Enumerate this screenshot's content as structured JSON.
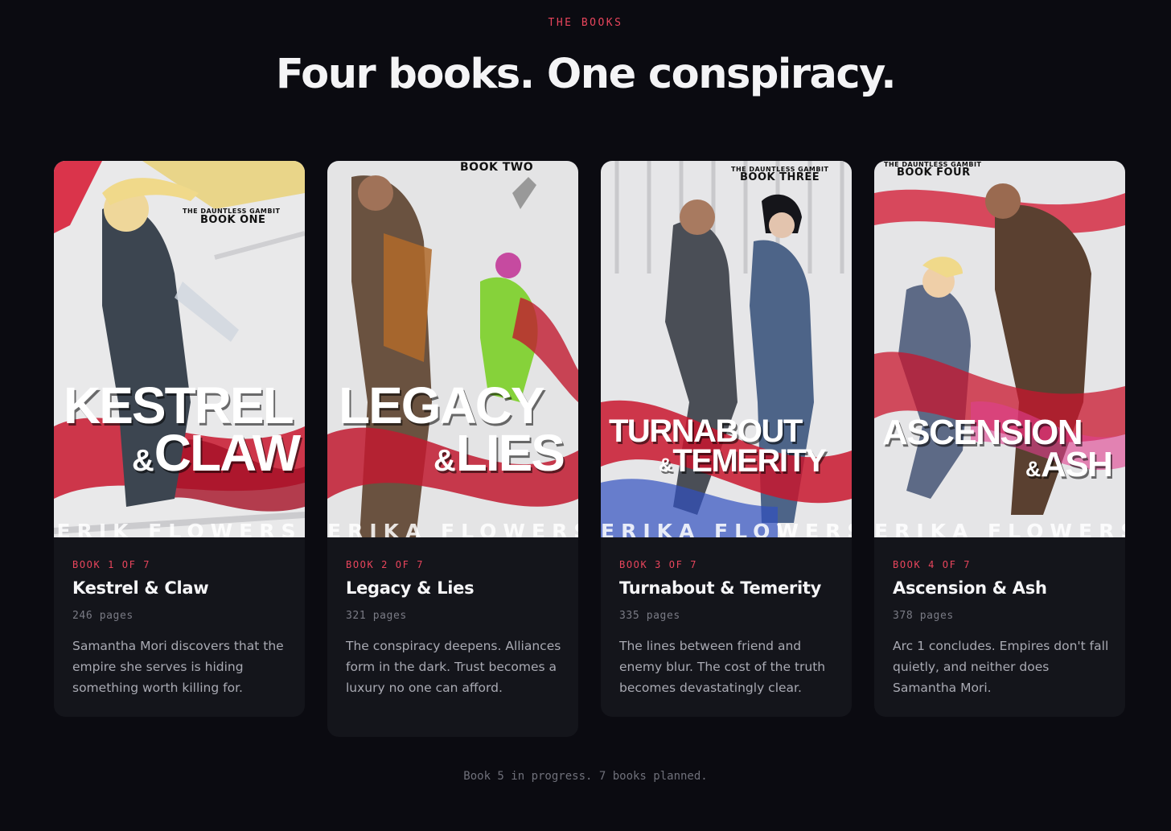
{
  "section": {
    "eyebrow": "THE BOOKS",
    "headline": "Four books. One conspiracy."
  },
  "colors": {
    "background": "#0b0b11",
    "card": "#14151b",
    "accent": "#e8455c",
    "muted": "#7a7b85"
  },
  "books": [
    {
      "series_small": "THE DAUNTLESS GAMBIT",
      "series_big": "BOOK ONE",
      "cover_title_1": "KESTREL",
      "cover_amp": "&",
      "cover_title_2": "CLAW",
      "cover_author": "ERIK FLOWERS",
      "label": "BOOK 1 OF 7",
      "title": "Kestrel & Claw",
      "pages": "246 pages",
      "description": "Samantha Mori discovers that the empire she serves is hiding something worth killing for."
    },
    {
      "series_big": "BOOK TWO",
      "cover_title_1": "LEGACY",
      "cover_amp": "&",
      "cover_title_2": "LIES",
      "cover_author": "ERIKA FLOWERS",
      "label": "BOOK 2 OF 7",
      "title": "Legacy & Lies",
      "pages": "321 pages",
      "description": "The conspiracy deepens. Alliances form in the dark. Trust becomes a luxury no one can afford."
    },
    {
      "series_small": "THE DAUNTLESS GAMBIT",
      "series_big": "BOOK THREE",
      "cover_title_1": "TURNABOUT",
      "cover_amp": "&",
      "cover_title_2": "TEMERITY",
      "cover_author": "ERIKA FLOWERS",
      "label": "BOOK 3 OF 7",
      "title": "Turnabout & Temerity",
      "pages": "335 pages",
      "description": "The lines between friend and enemy blur. The cost of the truth becomes devastatingly clear."
    },
    {
      "series_small": "THE DAUNTLESS GAMBIT",
      "series_big": "BOOK FOUR",
      "cover_title_1": "ASCENSION",
      "cover_amp": "&",
      "cover_title_2": "ASH",
      "cover_author": "ERIKA FLOWERS",
      "label": "BOOK 4 OF 7",
      "title": "Ascension & Ash",
      "pages": "378 pages",
      "description": "Arc 1 concludes. Empires don't fall quietly, and neither does Samantha Mori."
    }
  ],
  "footer": "Book 5 in progress. 7 books planned."
}
